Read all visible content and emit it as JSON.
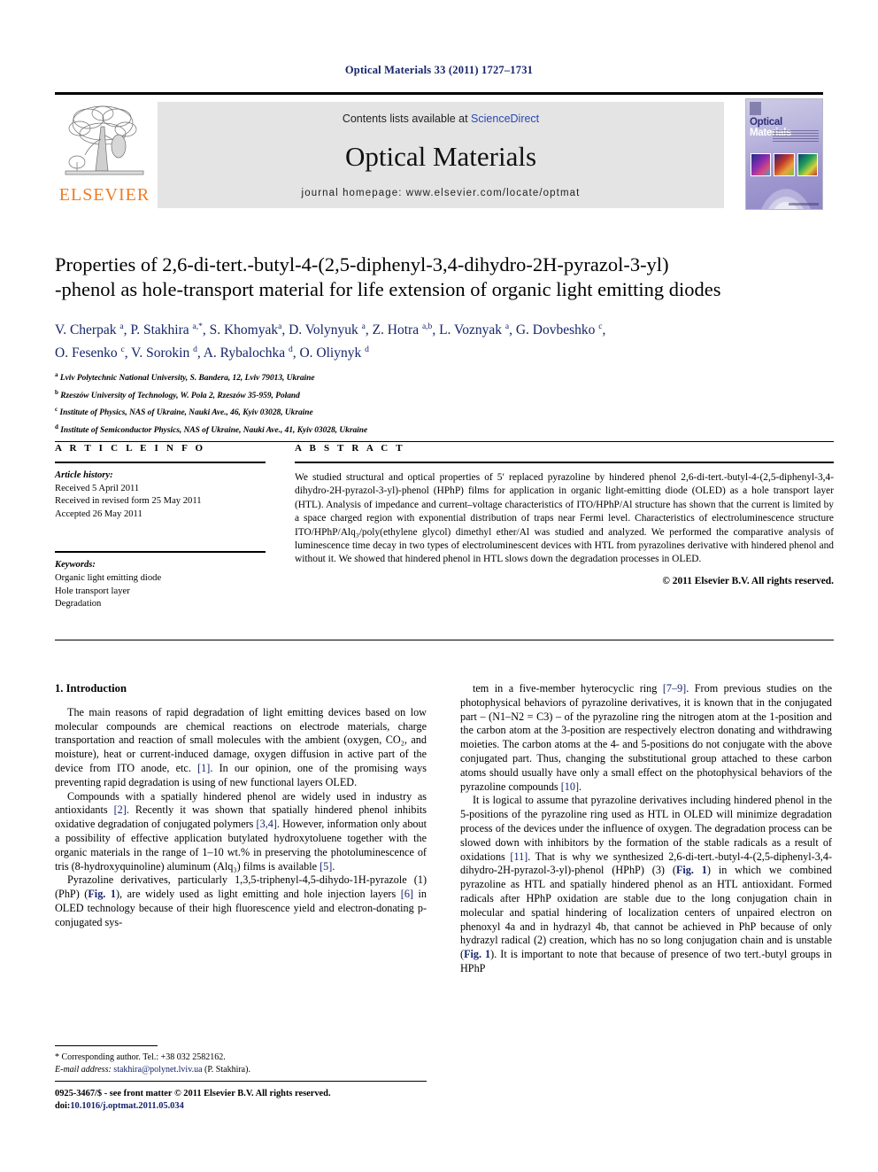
{
  "running_head": "Optical Materials 33 (2011) 1727–1731",
  "masthead": {
    "contents_prefix": "Contents lists available at ",
    "sciencedirect": "ScienceDirect",
    "journal_title": "Optical Materials",
    "homepage": "journal homepage: www.elsevier.com/locate/optmat",
    "publisher_wordmark": "ELSEVIER",
    "cover_title_part1": "Optical",
    "cover_title_part2": "Materials",
    "accent_orange": "#f07c22",
    "link_blue": "#2b47b5",
    "header_band": "#e4e4e4"
  },
  "article": {
    "title_line1": "Properties of 2,6-di-tert.-butyl-4-(2,5-diphenyl-3,4-dihydro-2H-pyrazol-3-yl)",
    "title_line2": "-phenol as hole-transport material for life extension of organic light emitting diodes",
    "authors_line1": "V. Cherpak <sup>a</sup>, P. Stakhira <sup>a,*</sup>, S. Khomyak<sup>a</sup>, D. Volynyuk <sup>a</sup>, Z. Hotra <sup>a,b</sup>, L. Voznyak <sup>a</sup>, G. Dovbeshko <sup>c</sup>,",
    "authors_line2": "O. Fesenko <sup>c</sup>, V. Sorokin <sup>d</sup>, A. Rybalochka <sup>d</sup>, O. Oliynyk <sup>d</sup>",
    "affiliations": [
      "<sup>a</sup> Lviv Polytechnic National University, S. Bandera, 12, Lviv 79013, Ukraine",
      "<sup>b</sup> Rzeszów University of Technology, W. Pola 2, Rzeszów 35-959, Poland",
      "<sup>c</sup> Institute of Physics, NAS of Ukraine, Nauki Ave., 46, Kyiv 03028, Ukraine",
      "<sup>d</sup> Institute of Semiconductor Physics, NAS of Ukraine, Nauki Ave., 41, Kyiv 03028, Ukraine"
    ]
  },
  "info": {
    "heading": "A R T I C L E    I N F O",
    "history_label": "Article history:",
    "history": [
      "Received 5 April 2011",
      "Received in revised form 25 May 2011",
      "Accepted 26 May 2011"
    ],
    "keywords_label": "Keywords:",
    "keywords": [
      "Organic light emitting diode",
      "Hole transport layer",
      "Degradation"
    ]
  },
  "abstract": {
    "heading": "A B S T R A C T",
    "body": "We studied structural and optical properties of 5′ replaced pyrazoline by hindered phenol 2,6-di-tert.-butyl-4-(2,5-diphenyl-3,4-dihydro-2H-pyrazol-3-yl)-phenol (HPhP) films for application in organic light-emitting diode (OLED) as a hole transport layer (HTL). Analysis of impedance and current–voltage characteristics of ITO/HPhP/Al structure has shown that the current is limited by a space charged region with exponential distribution of traps near Fermi level. Characteristics of electroluminescence structure ITO/HPhP/Alq₃/poly(ethylene glycol) dimethyl ether/Al was studied and analyzed. We performed the comparative analysis of luminescence time decay in two types of electroluminescent devices with HTL from pyrazolines derivative with hindered phenol and without it. We showed that hindered phenol in HTL slows down the degradation processes in OLED.",
    "copyright": "© 2011 Elsevier B.V. All rights reserved."
  },
  "body": {
    "section_heading": "1. Introduction",
    "left_paragraphs": [
      "The main reasons of rapid degradation of light emitting devices based on low molecular compounds are chemical reactions on electrode materials, charge transportation and reaction of small molecules with the ambient (oxygen, CO₂, and moisture), heat or current-induced damage, oxygen diffusion in active part of the device from ITO anode, etc. <span class=\"ref\">[1]</span>. In our opinion, one of the promising ways preventing rapid degradation is using of new functional layers OLED.",
      "Compounds with a spatially hindered phenol are widely used in industry as antioxidants <span class=\"ref\">[2]</span>. Recently it was shown that spatially hindered phenol inhibits oxidative degradation of conjugated polymers <span class=\"ref\">[3,4]</span>. However, information only about a possibility of effective application butylated hydroxytoluene together with the organic materials in the range of 1–10 wt.% in preserving the photoluminescence of tris (8-hydroxyquinoline) aluminum (Alq₃) films is available <span class=\"ref\">[5]</span>.",
      "Pyrazoline derivatives, particularly 1,3,5-triphenyl-4,5-dihydo-1H-pyrazole (1) (PhP) (<span class=\"figref\">Fig. 1</span>), are widely used as light emitting and hole injection layers <span class=\"ref\">[6]</span> in OLED technology because of their high fluorescence yield and electron-donating p-conjugated sys-"
    ],
    "right_paragraphs": [
      "tem in a five-member hyterocyclic ring <span class=\"ref\">[7–9]</span>. From previous studies on the photophysical behaviors of pyrazoline derivatives, it is known that in the conjugated part – (N1–N2 = C3) – of the pyrazoline ring the nitrogen atom at the 1-position and the carbon atom at the 3-position are respectively electron donating and withdrawing moieties. The carbon atoms at the 4- and 5-positions do not conjugate with the above conjugated part. Thus, changing the substitutional group attached to these carbon atoms should usually have only a small effect on the photophysical behaviors of the pyrazoline compounds <span class=\"ref\">[10]</span>.",
      "It is logical to assume that pyrazoline derivatives including hindered phenol in the 5-positions of the pyrazoline ring used as HTL in OLED will minimize degradation process of the devices under the influence of oxygen. The degradation process can be slowed down with inhibitors by the formation of the stable radicals as a result of oxidations <span class=\"ref\">[11]</span>. That is why we synthesized 2,6-di-tert.-butyl-4-(2,5-diphenyl-3,4-dihydro-2H-pyrazol-3-yl)-phenol (HPhP) (3) (<span class=\"figref\">Fig. 1</span>) in which we combined pyrazoline as HTL and spatially hindered phenol as an HTL antioxidant. Formed radicals after HPhP oxidation are stable due to the long conjugation chain in molecular and spatial hindering of localization centers of unpaired electron on phenoxyl 4a and in hydrazyl 4b, that cannot be achieved in PhP because of only hydrazyl radical (2) creation, which has no so long conjugation chain and is unstable (<span class=\"figref\">Fig. 1</span>). It is important to note that because of presence of two tert.-butyl groups in HPhP"
    ]
  },
  "footnote": {
    "corresponding": "* Corresponding author. Tel.: +38 032 2582162.",
    "email_label": "E-mail address:",
    "email": "stakhira@polynet.lviv.ua",
    "email_owner": "(P. Stakhira)."
  },
  "footer": {
    "issn_line": "0925-3467/$ - see front matter © 2011 Elsevier B.V. All rights reserved.",
    "doi_prefix": "doi:",
    "doi": "10.1016/j.optmat.2011.05.034"
  }
}
